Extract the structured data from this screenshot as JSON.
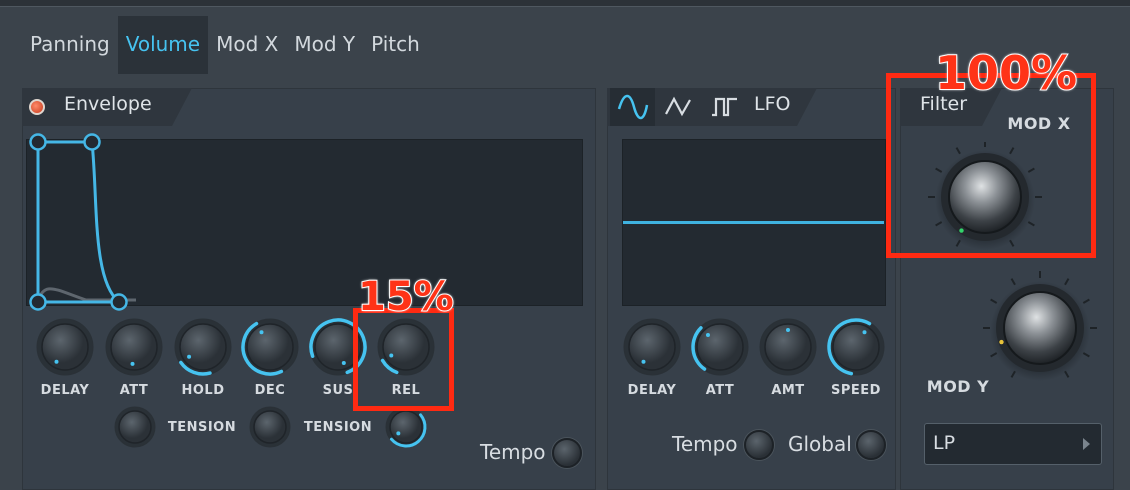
{
  "tabs": [
    "Panning",
    "Volume",
    "Mod X",
    "Mod Y",
    "Pitch"
  ],
  "active_tab": "Volume",
  "envelope": {
    "title": "Envelope",
    "knobs": [
      "DELAY",
      "ATT",
      "HOLD",
      "DEC",
      "SUS",
      "REL"
    ],
    "tension_label_1": "TENSION",
    "tension_label_2": "TENSION",
    "tempo_label": "Tempo"
  },
  "lfo": {
    "title": "LFO",
    "shapes": [
      "sine-wave-icon",
      "triangle-wave-icon",
      "pulse-wave-icon"
    ],
    "knobs": [
      "DELAY",
      "ATT",
      "AMT",
      "SPEED"
    ],
    "tempo_label": "Tempo",
    "global_label": "Global"
  },
  "filter": {
    "title": "Filter",
    "mod_x_label": "MOD X",
    "mod_y_label": "MOD Y",
    "type_value": "LP"
  },
  "annotations": {
    "mod_x_value": "100%",
    "rel_value": "15%"
  },
  "colors": {
    "accent": "#46c3f0",
    "highlight": "#ff2a12",
    "background": "#3b434b",
    "display": "#232a31"
  }
}
